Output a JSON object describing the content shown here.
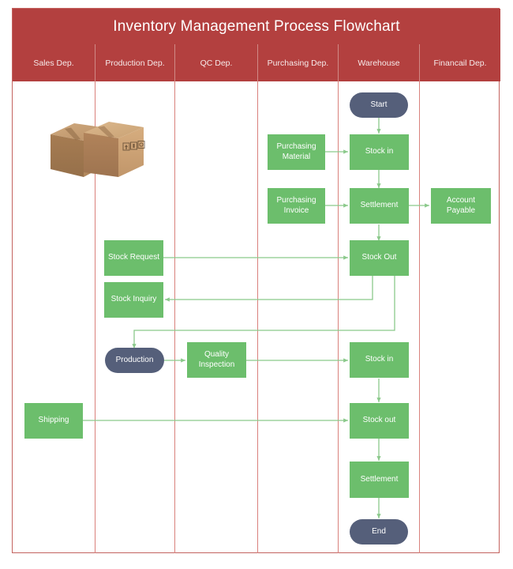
{
  "diagram": {
    "title": "Inventory Management Process Flowchart",
    "type": "cross-functional-swimlane-flowchart",
    "colors": {
      "header_red": "#b3403f",
      "lane_divider": "#d9817c",
      "process_green": "#6cbe6c",
      "terminator_slate": "#555f7a",
      "connector_green": "#8bc98b",
      "frame_border": "#c4635f"
    }
  },
  "lanes": [
    {
      "id": "sales",
      "label": "Sales Dep."
    },
    {
      "id": "production",
      "label": "Production Dep."
    },
    {
      "id": "qc",
      "label": "QC Dep."
    },
    {
      "id": "purchasing",
      "label": "Purchasing Dep."
    },
    {
      "id": "warehouse",
      "label": "Warehouse"
    },
    {
      "id": "financial",
      "label": "Financail Dep."
    }
  ],
  "nodes": {
    "start": {
      "label": "Start",
      "shape": "terminator",
      "lane": "warehouse"
    },
    "purchasing_material": {
      "label": "Purchasing Material",
      "shape": "process",
      "lane": "purchasing"
    },
    "stock_in_1": {
      "label": "Stock in",
      "shape": "process",
      "lane": "warehouse"
    },
    "purchasing_invoice": {
      "label": "Purchasing Invoice",
      "shape": "process",
      "lane": "purchasing"
    },
    "settlement_1": {
      "label": "Settlement",
      "shape": "process",
      "lane": "warehouse"
    },
    "account_payable": {
      "label": "Account Payable",
      "shape": "process",
      "lane": "financial"
    },
    "stock_request": {
      "label": "Stock Request",
      "shape": "process",
      "lane": "production"
    },
    "stock_out_1": {
      "label": "Stock Out",
      "shape": "process",
      "lane": "warehouse"
    },
    "stock_inquiry": {
      "label": "Stock Inquiry",
      "shape": "process",
      "lane": "production"
    },
    "production": {
      "label": "Production",
      "shape": "terminator",
      "lane": "production"
    },
    "quality_inspection": {
      "label": "Quality Inspection",
      "shape": "process",
      "lane": "qc"
    },
    "stock_in_2": {
      "label": "Stock in",
      "shape": "process",
      "lane": "warehouse"
    },
    "shipping": {
      "label": "Shipping",
      "shape": "process",
      "lane": "sales"
    },
    "stock_out_2": {
      "label": "Stock out",
      "shape": "process",
      "lane": "warehouse"
    },
    "settlement_2": {
      "label": "Settlement",
      "shape": "process",
      "lane": "warehouse"
    },
    "end": {
      "label": "End",
      "shape": "terminator",
      "lane": "warehouse"
    }
  },
  "edges": [
    {
      "from": "start",
      "to": "stock_in_1"
    },
    {
      "from": "purchasing_material",
      "to": "stock_in_1"
    },
    {
      "from": "stock_in_1",
      "to": "settlement_1"
    },
    {
      "from": "purchasing_invoice",
      "to": "settlement_1"
    },
    {
      "from": "settlement_1",
      "to": "account_payable"
    },
    {
      "from": "settlement_1",
      "to": "stock_out_1"
    },
    {
      "from": "stock_request",
      "to": "stock_out_1"
    },
    {
      "from": "stock_out_1",
      "to": "stock_inquiry"
    },
    {
      "from": "stock_out_1",
      "to": "production"
    },
    {
      "from": "production",
      "to": "quality_inspection"
    },
    {
      "from": "quality_inspection",
      "to": "stock_in_2"
    },
    {
      "from": "stock_in_2",
      "to": "stock_out_2"
    },
    {
      "from": "shipping",
      "to": "stock_out_2"
    },
    {
      "from": "stock_out_2",
      "to": "settlement_2"
    },
    {
      "from": "settlement_2",
      "to": "end"
    }
  ],
  "illustration": {
    "name": "cardboard-boxes-illustration",
    "description": "Two sealed cardboard shipping cartons with handling symbols",
    "symbols": [
      "fragile-symbol",
      "keep-dry-symbol",
      "this-side-up-symbol"
    ]
  }
}
